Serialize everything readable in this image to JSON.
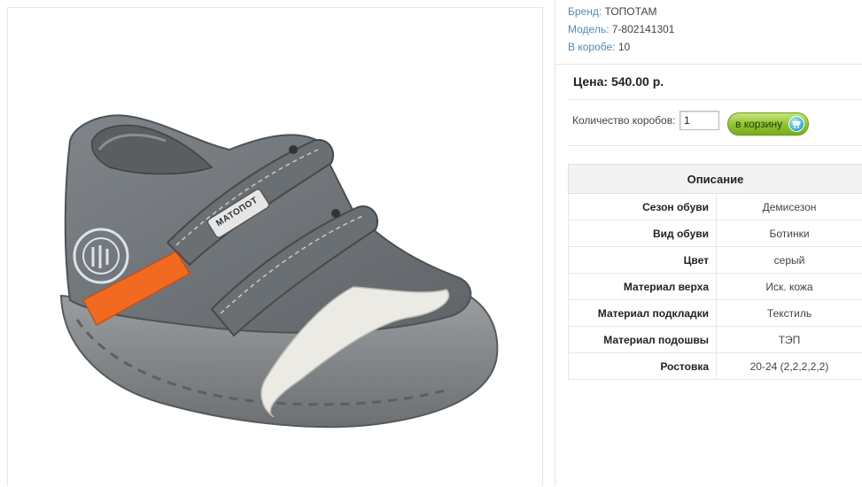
{
  "product": {
    "brand_label": "Бренд:",
    "brand": "ТОПОТАМ",
    "model_label": "Модель:",
    "model": "7-802141301",
    "box_label": "В коробе:",
    "box_count": "10",
    "shoe_badge_text": "МАТОПОТ"
  },
  "purchase": {
    "price": "Цена: 540.00 р.",
    "qty_label": "Количество коробов:",
    "qty_value": "1",
    "cart_label": "в корзину",
    "cart_icon": "cart-icon"
  },
  "description": {
    "title": "Описание",
    "rows": [
      {
        "key": "Сезон обуви",
        "value": "Демисезон"
      },
      {
        "key": "Вид обуви",
        "value": "Ботинки"
      },
      {
        "key": "Цвет",
        "value": "серый"
      },
      {
        "key": "Материал верха",
        "value": "Иск. кожа"
      },
      {
        "key": "Материал подкладки",
        "value": "Текстиль"
      },
      {
        "key": "Материал подошвы",
        "value": "ТЭП"
      },
      {
        "key": "Ростовка",
        "value": "20-24 (2,2,2,2,2)"
      }
    ]
  },
  "colors": {
    "link": "#4a8ac8",
    "cart_green": "#8fc22f",
    "shoe_gray": "#6f7477",
    "stripe_orange": "#f06a22"
  }
}
